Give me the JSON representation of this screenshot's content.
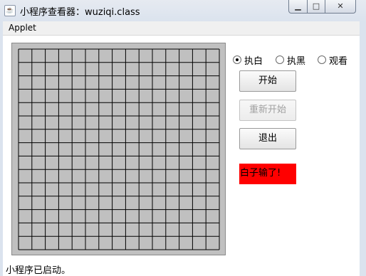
{
  "window": {
    "title": "小程序查看器：wuziqi.class",
    "icon": "java-cup-icon",
    "controls": {
      "minimize": "▁",
      "maximize": "□",
      "close": "✕"
    }
  },
  "menubar": {
    "items": [
      {
        "label": "Applet"
      }
    ]
  },
  "game": {
    "board": {
      "rows": 15,
      "cols": 15,
      "background": "#c0c0c0"
    },
    "mode_options": [
      {
        "label": "执白",
        "checked": true
      },
      {
        "label": "执黑",
        "checked": false
      },
      {
        "label": "观看",
        "checked": false
      }
    ],
    "buttons": {
      "start": "开始",
      "restart": "重新开始",
      "exit": "退出"
    },
    "result_message": "白子输了!",
    "result_color": "#ff0000"
  },
  "status": {
    "message": "小程序已启动。"
  }
}
